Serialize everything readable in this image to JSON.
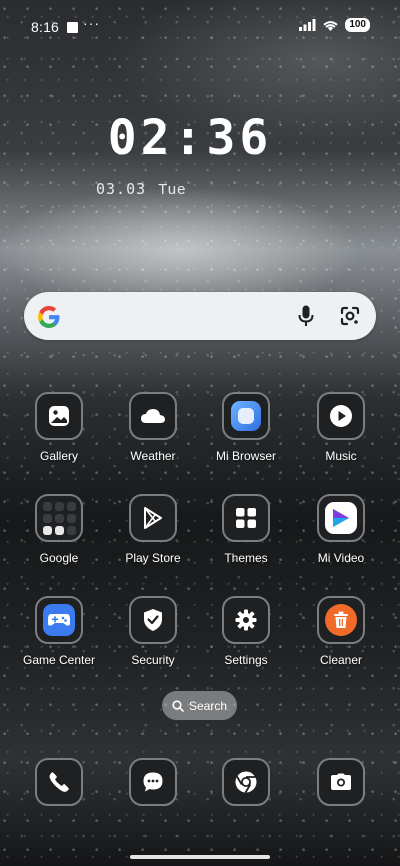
{
  "status": {
    "time": "8:16",
    "dots": "···",
    "battery": "100"
  },
  "clock": {
    "time": "02:36",
    "date": "03.03",
    "day": "Tue"
  },
  "search_bar": {
    "google_icon": "google-g-icon",
    "mic_icon": "mic-icon",
    "lens_icon": "google-lens-icon"
  },
  "apps": [
    {
      "label": "Gallery",
      "icon": "gallery-icon"
    },
    {
      "label": "Weather",
      "icon": "cloud-icon"
    },
    {
      "label": "Mi Browser",
      "icon": "browser-icon"
    },
    {
      "label": "Music",
      "icon": "play-icon"
    },
    {
      "label": "Google",
      "icon": "folder-icon"
    },
    {
      "label": "Play Store",
      "icon": "play-store-icon"
    },
    {
      "label": "Themes",
      "icon": "grid-icon"
    },
    {
      "label": "Mi Video",
      "icon": "video-icon"
    },
    {
      "label": "Game Center",
      "icon": "gamepad-icon"
    },
    {
      "label": "Security",
      "icon": "shield-check-icon"
    },
    {
      "label": "Settings",
      "icon": "gear-icon"
    },
    {
      "label": "Cleaner",
      "icon": "trash-icon"
    }
  ],
  "page_search": {
    "label": "Search",
    "icon": "search-icon"
  },
  "dock": [
    {
      "name": "phone",
      "icon": "phone-icon"
    },
    {
      "name": "messages",
      "icon": "message-icon"
    },
    {
      "name": "chrome",
      "icon": "chrome-icon"
    },
    {
      "name": "camera",
      "icon": "camera-icon"
    }
  ],
  "colors": {
    "tile_bg": "#1f2022",
    "tile_border": "#7b7d80",
    "browser_blue": "#4a90e8",
    "cleaner_orange": "#f06a2a",
    "game_blue": "#3a7bf0"
  }
}
